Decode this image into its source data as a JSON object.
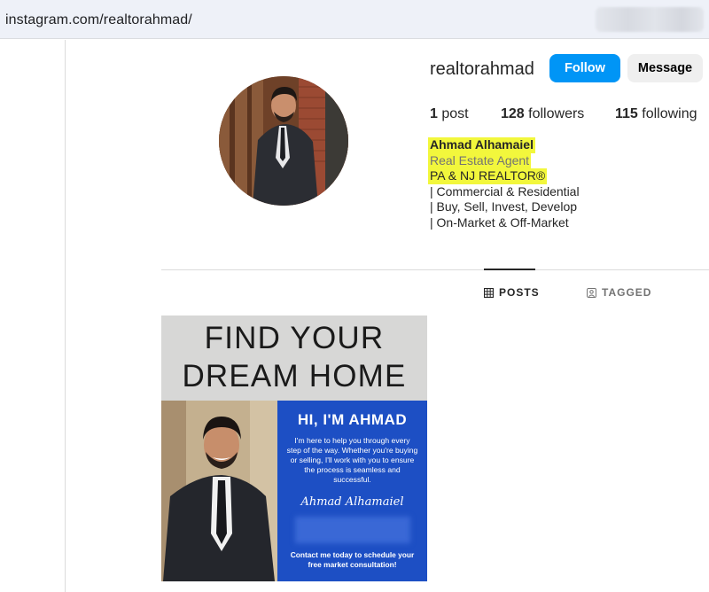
{
  "browser": {
    "url": "instagram.com/realtorahmad/"
  },
  "profile": {
    "username": "realtorahmad",
    "follow_label": "Follow",
    "message_label": "Message",
    "stats": {
      "posts_count": "1",
      "posts_label": "post",
      "followers_count": "128",
      "followers_label": "followers",
      "following_count": "115",
      "following_label": "following"
    },
    "bio": {
      "name": "Ahmad Alhamaiel",
      "category": "Real Estate Agent",
      "lines": [
        "PA & NJ REALTOR®",
        "| Commercial & Residential",
        "| Buy, Sell, Invest, Develop",
        "| On-Market & Off-Market"
      ]
    }
  },
  "tabs": [
    {
      "label": "POSTS",
      "icon": "grid-icon",
      "active": true
    },
    {
      "label": "TAGGED",
      "icon": "tagged-icon",
      "active": false
    }
  ],
  "post": {
    "headline_line1": "FIND YOUR",
    "headline_line2": "DREAM HOME",
    "greeting": "HI, I'M AHMAD",
    "body": "I'm here to help you through every step of the way. Whether you're buying or selling, I'll work with you to ensure the process is seamless and successful.",
    "signature": "Ahmad Alhamaiel",
    "cta": "Contact me today to schedule your free market consultation!"
  },
  "colors": {
    "follow_button": "#0095f6",
    "highlight": "#f2f73c",
    "post_blue": "#1d4fc4"
  }
}
